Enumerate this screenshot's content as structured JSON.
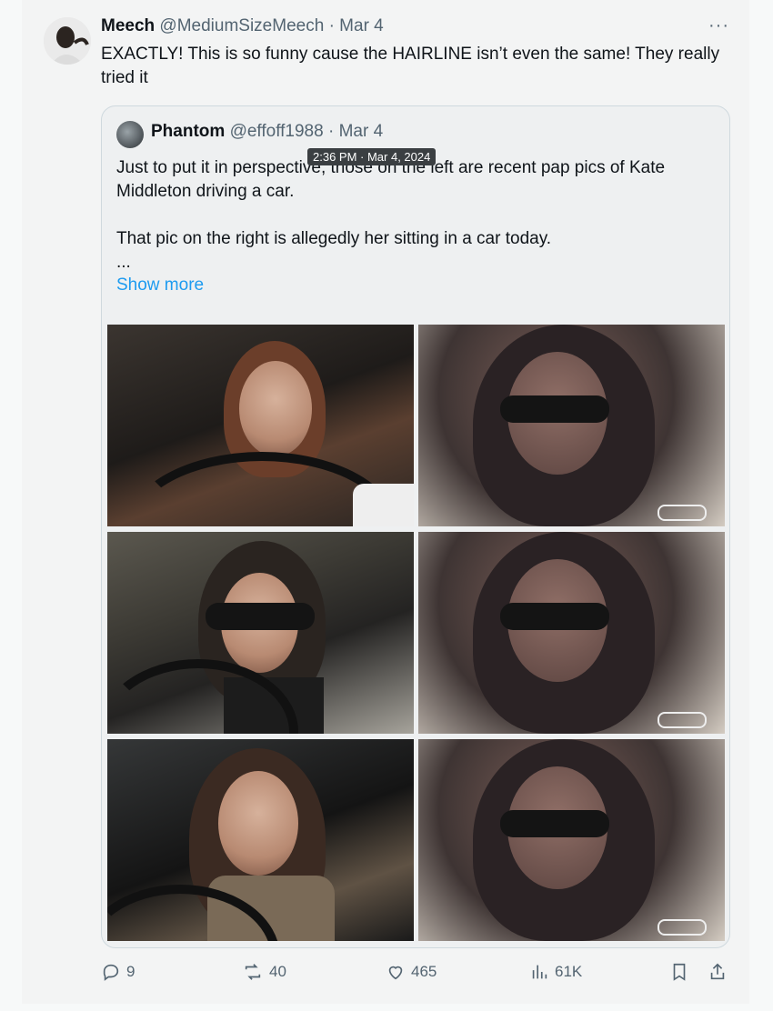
{
  "post": {
    "author_name": "Meech",
    "author_handle": "@MediumSizeMeech",
    "separator": "·",
    "date": "Mar 4",
    "more_label": "···",
    "text": "EXACTLY! This is so funny cause the HAIRLINE isn’t even the same! They really tried it"
  },
  "quote": {
    "author_name": "Phantom",
    "author_handle": "@effoff1988",
    "separator": "·",
    "date": "Mar 4",
    "tooltip": "2:36 PM · Mar 4, 2024",
    "line1": "Just to put it in perspective, those on the left are recent  pap pics of Kate Middleton driving a car.",
    "line2": "That pic on the right is allegedly her sitting in a car today.",
    "ellipsis": "...",
    "show_more": "Show more"
  },
  "actions": {
    "replies": "9",
    "reposts": "40",
    "likes": "465",
    "views": "61K"
  },
  "colors": {
    "link": "#1d9bf0",
    "muted": "#536471",
    "text": "#0f1419"
  }
}
